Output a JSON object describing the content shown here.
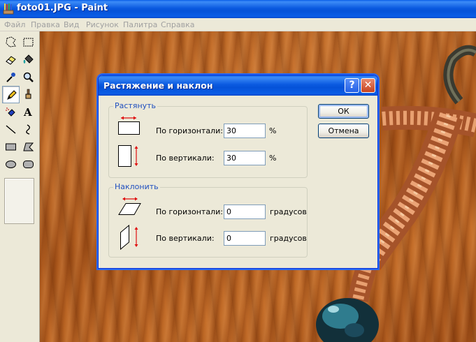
{
  "window": {
    "title": "foto01.JPG - Paint"
  },
  "menu": [
    "Файл",
    "Правка",
    "Вид",
    "Рисунок",
    "Палитра",
    "Справка"
  ],
  "toolbox": {
    "tools": [
      "free-select-icon",
      "rect-select-icon",
      "eraser-icon",
      "fill-bucket-icon",
      "color-picker-icon",
      "magnifier-icon",
      "pencil-icon",
      "brush-icon",
      "airbrush-icon",
      "text-icon",
      "line-icon",
      "curve-icon",
      "rectangle-icon",
      "polygon-icon",
      "ellipse-icon",
      "rounded-rect-icon"
    ],
    "active_tool": "pencil-icon"
  },
  "dialog": {
    "title": "Растяжение и наклон",
    "help_label": "?",
    "close_label": "✕",
    "stretch": {
      "label": "Растянуть",
      "horizontal_label": "По горизонтали:",
      "horizontal_value": "30",
      "horizontal_unit": "%",
      "vertical_label": "По вертикали:",
      "vertical_value": "30",
      "vertical_unit": "%"
    },
    "skew": {
      "label": "Наклонить",
      "horizontal_label": "По горизонтали:",
      "horizontal_value": "0",
      "horizontal_unit": "градусов",
      "vertical_label": "По вертикали:",
      "vertical_value": "0",
      "vertical_unit": "градусов"
    },
    "ok_label": "ОК",
    "cancel_label": "Отмена"
  },
  "colors": {
    "title_blue": "#0552d8",
    "group_label": "#1f4fbf",
    "arrow_red": "#e01010"
  }
}
